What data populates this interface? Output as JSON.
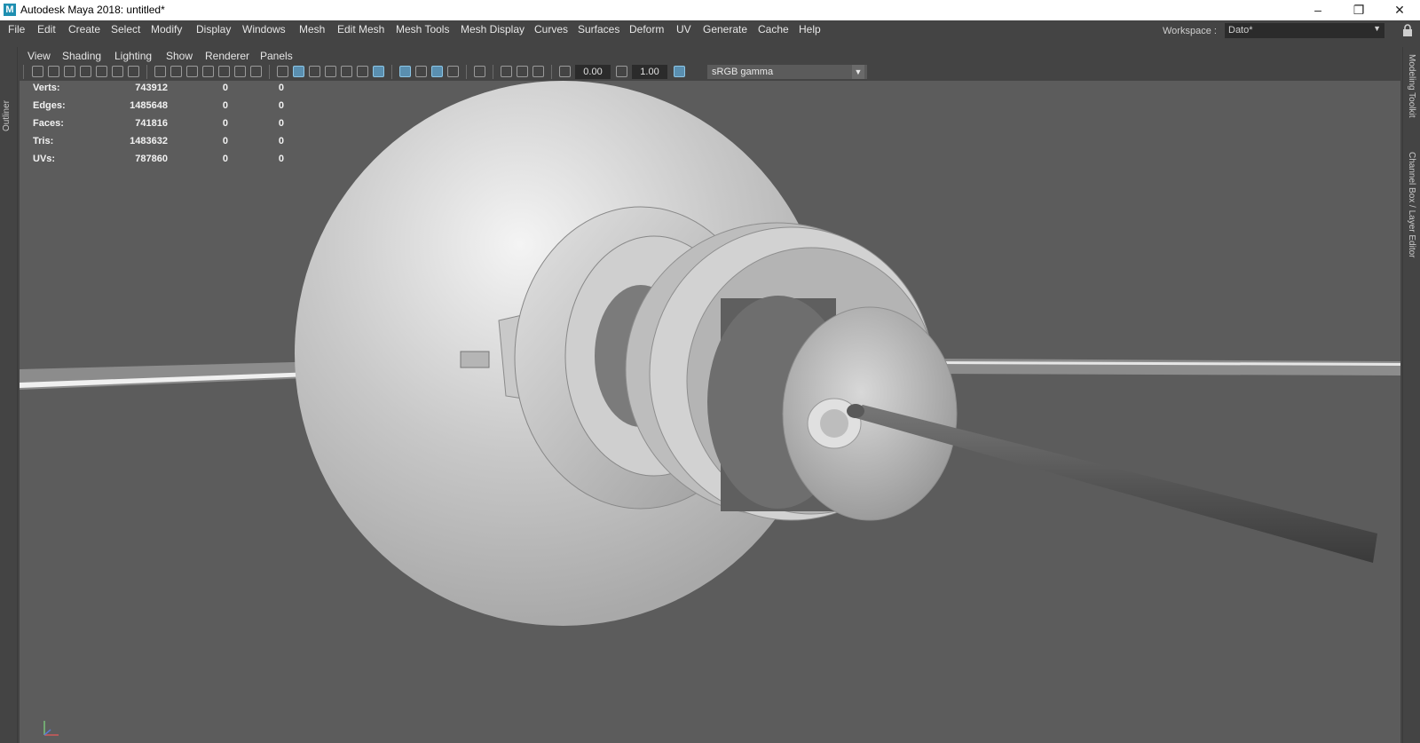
{
  "window": {
    "title": "Autodesk Maya 2018: untitled*",
    "app_icon": "M",
    "controls": [
      "–",
      "❐",
      "✕"
    ]
  },
  "menubar": {
    "items": [
      "File",
      "Edit",
      "Create",
      "Select",
      "Modify",
      "Display",
      "Windows",
      "Mesh",
      "Edit Mesh",
      "Mesh Tools",
      "Mesh Display",
      "Curves",
      "Surfaces",
      "Deform",
      "UV",
      "Generate",
      "Cache",
      "Help"
    ],
    "workspace_label": "Workspace :",
    "workspace_value": "Dato*"
  },
  "side_tabs": {
    "left": "Outliner",
    "right": [
      "Modeling Toolkit",
      "Channel Box / Layer Editor"
    ]
  },
  "panel_menu": {
    "items": [
      "View",
      "Shading",
      "Lighting",
      "Show",
      "Renderer",
      "Panels"
    ]
  },
  "panel_toolbar": {
    "exposure": "0.00",
    "gamma": "1.00",
    "color_space": "sRGB gamma"
  },
  "hud": {
    "rows": [
      {
        "label": "Verts:",
        "values": [
          "743912",
          "0",
          "0"
        ]
      },
      {
        "label": "Edges:",
        "values": [
          "1485648",
          "0",
          "0"
        ]
      },
      {
        "label": "Faces:",
        "values": [
          "741816",
          "0",
          "0"
        ]
      },
      {
        "label": "Tris:",
        "values": [
          "1483632",
          "0",
          "0"
        ]
      },
      {
        "label": "UVs:",
        "values": [
          "787860",
          "0",
          "0"
        ]
      }
    ]
  },
  "viewport": {
    "background": "#5c5c5c",
    "model": "satellite-model"
  }
}
